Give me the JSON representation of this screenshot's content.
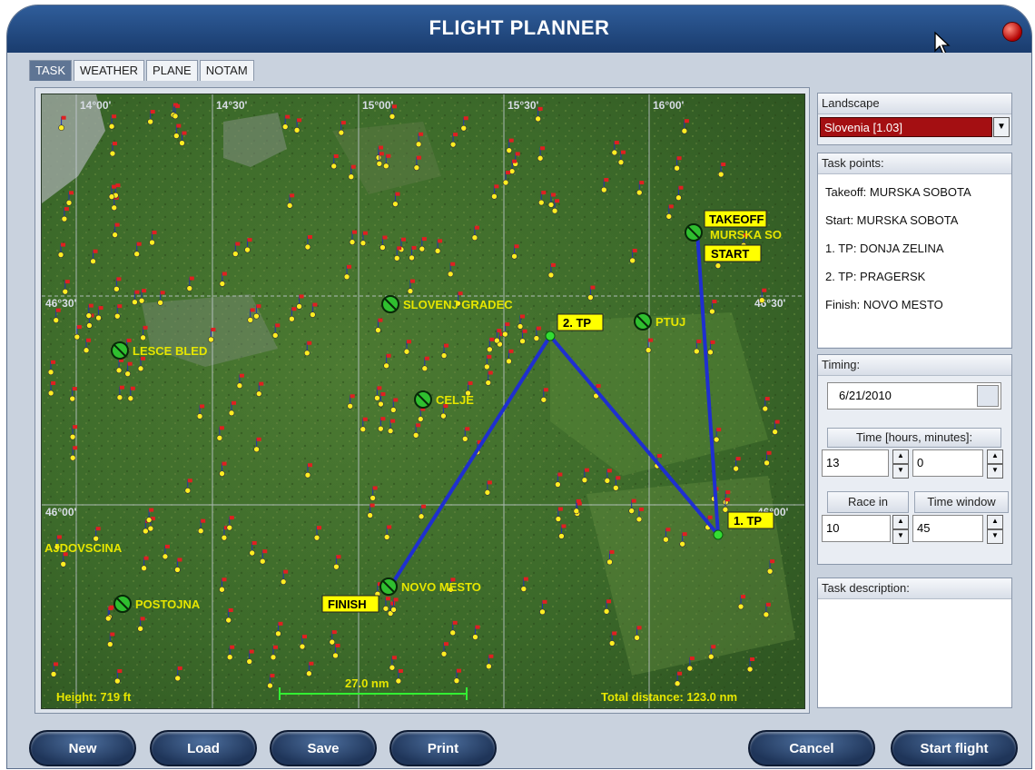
{
  "window": {
    "title": "FLIGHT PLANNER"
  },
  "tabs": [
    "TASK",
    "WEATHER",
    "PLANE",
    "NOTAM"
  ],
  "map": {
    "longitude_labels": [
      "14°00'",
      "14°30'",
      "15°00'",
      "15°30'",
      "16°00'"
    ],
    "latitude_labels_left": [
      "46°30'",
      "46°00'"
    ],
    "latitude_labels_right": [
      "46°30'",
      "46°00'"
    ],
    "cities": [
      "SLOVENJ GRADEC",
      "PTUJ",
      "LESCE BLED",
      "CELJE",
      "AJDOVSCINA",
      "POSTOJNA",
      "NOVO MESTO",
      "MURSKA SO"
    ],
    "markers": {
      "takeoff": "TAKEOFF",
      "start": "START",
      "tp1": "1. TP",
      "tp2": "2. TP",
      "finish": "FINISH"
    },
    "height": "Height: 719 ft",
    "scale": "27.0 nm",
    "total_distance": "Total distance: 123.0 nm",
    "colors": {
      "route": "#1f2fd0",
      "label_bg": "#ffff00",
      "city_text": "#e6e600"
    }
  },
  "landscape": {
    "label": "Landscape",
    "selected": "Slovenia [1.03]"
  },
  "task_points": {
    "label": "Task points:",
    "items": [
      "Takeoff: MURSKA SOBOTA",
      "Start: MURSKA SOBOTA",
      "1. TP: DONJA ZELINA",
      "2. TP: PRAGERSK",
      "Finish: NOVO MESTO"
    ]
  },
  "timing": {
    "label": "Timing:",
    "date": "6/21/2010",
    "time_label": "Time [hours, minutes]:",
    "hours": "13",
    "minutes": "0",
    "race_in_label": "Race in",
    "race_in": "10",
    "time_window_label": "Time window",
    "time_window": "45"
  },
  "task_description": {
    "label": "Task description:"
  },
  "buttons": {
    "new": "New",
    "load": "Load",
    "save": "Save",
    "print": "Print",
    "cancel": "Cancel",
    "start_flight": "Start flight"
  }
}
